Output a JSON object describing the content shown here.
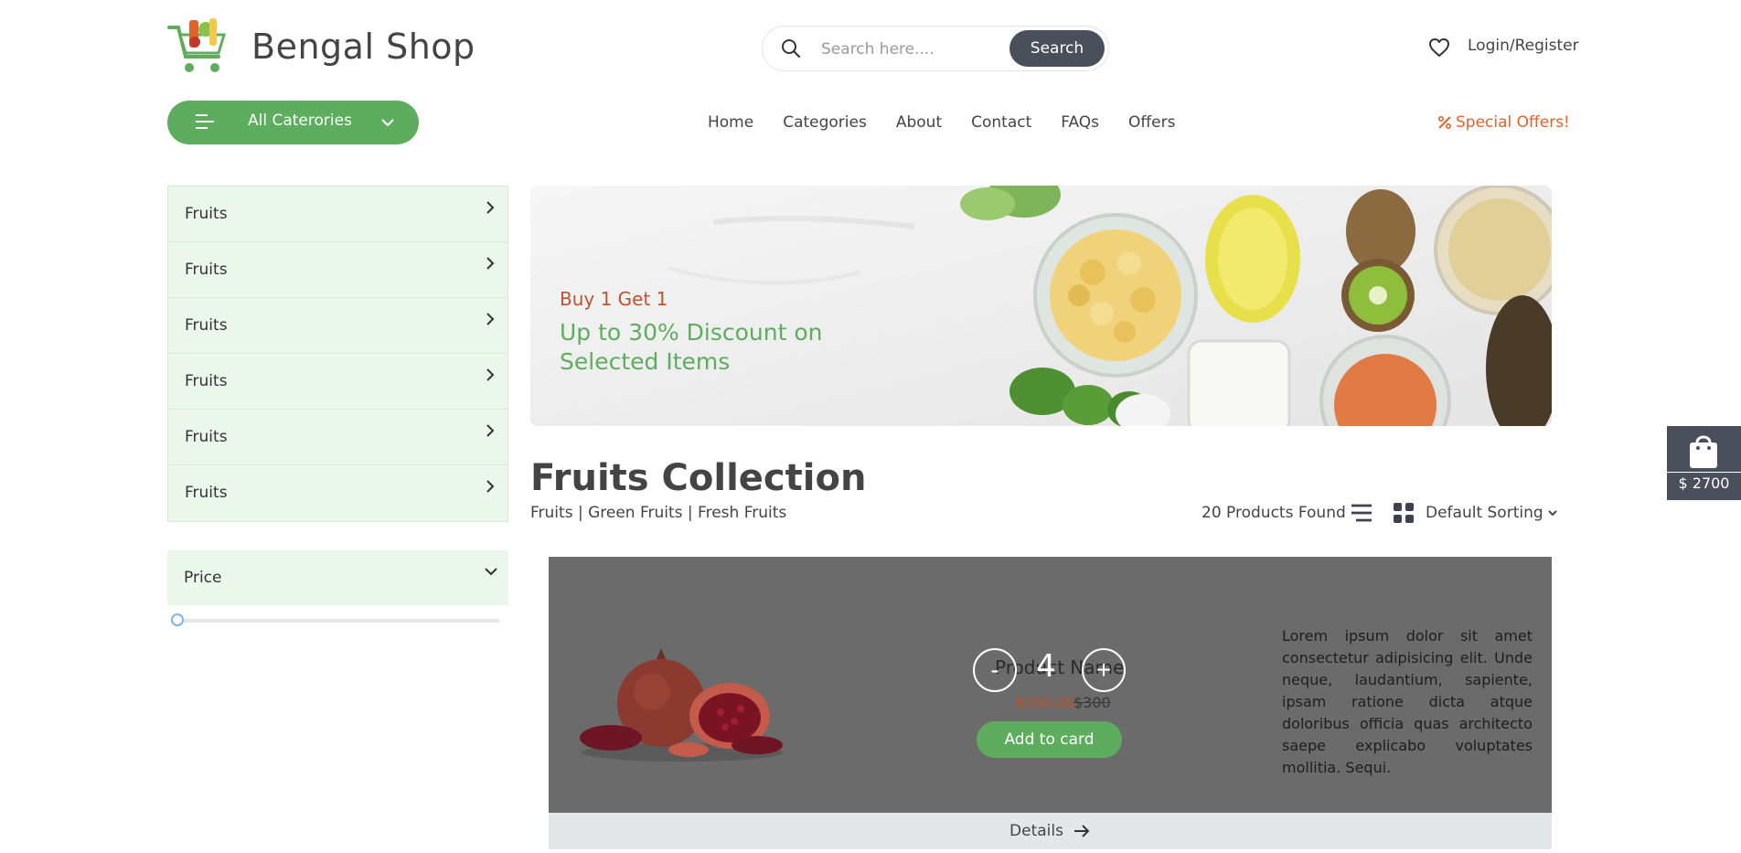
{
  "header": {
    "brand": "Bengal Shop",
    "search_placeholder": "Search here....",
    "search_button": "Search",
    "login_label": "Login/Register"
  },
  "categories_button": "All Caterories",
  "nav": [
    "Home",
    "Categories",
    "About",
    "Contact",
    "FAQs",
    "Offers"
  ],
  "special_offers": "Special Offers!",
  "sidebar": {
    "items": [
      "Fruits",
      "Fruits",
      "Fruits",
      "Fruits",
      "Fruits",
      "Fruits"
    ],
    "price_label": "Price",
    "price_slider_value": 0
  },
  "banner": {
    "kicker": "Buy 1 Get 1",
    "headline": "Up to 30% Discount on Selected Items"
  },
  "collection": {
    "title": "Fruits Collection",
    "breadcrumb": "Fruits | Green Fruits | Fresh Fruits",
    "found": "20 Products Found",
    "sorting": "Default Sorting"
  },
  "product": {
    "name": "Product Name",
    "quantity": "4",
    "minus": "-",
    "plus": "+",
    "price": "$200.00",
    "old_price": "$300",
    "add_button": "Add to card",
    "description": "Lorem ipsum dolor sit amet consectetur adipisicing elit. Unde neque, laudantium, sapiente, ipsam ratione dicta atque doloribus officia quas architecto saepe explicabo voluptates mollitia. Sequi.",
    "details_label": "Details"
  },
  "cart": {
    "total": "$ 2700"
  },
  "colors": {
    "brand_green": "#5ead5e",
    "accent_orange": "#e0622a",
    "dark_button": "#4a4f5c",
    "sidebar_bg": "#ecf7ec"
  }
}
